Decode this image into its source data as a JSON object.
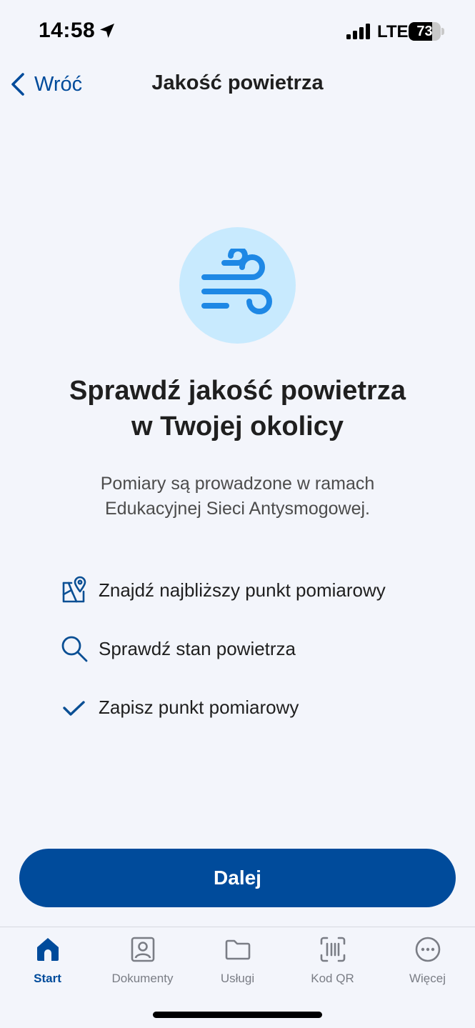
{
  "status_bar": {
    "time": "14:58",
    "network": "LTE",
    "battery_level": 73,
    "battery_label": "73",
    "icons": [
      "location-arrow-icon",
      "signal-icon",
      "battery-icon"
    ]
  },
  "nav": {
    "back_label": "Wróć",
    "title": "Jakość powietrza"
  },
  "hero": {
    "icon": "wind-icon",
    "circle_color": "#c8eafe",
    "icon_color": "#1e88e5"
  },
  "headline": {
    "line1": "Sprawdź jakość powietrza",
    "line2": "w Twojej okolicy"
  },
  "subtext": {
    "line1": "Pomiary są prowadzone w ramach",
    "line2": "Edukacyjnej Sieci Antysmogowej."
  },
  "features": [
    {
      "icon": "map-pin-icon",
      "label": "Znajdź najbliższy punkt pomiarowy"
    },
    {
      "icon": "search-icon",
      "label": "Sprawdź stan powietrza"
    },
    {
      "icon": "checkmark-icon",
      "label": "Zapisz punkt pomiarowy"
    }
  ],
  "primary_button": {
    "label": "Dalej"
  },
  "tab_bar": {
    "active": "Start",
    "tabs": [
      {
        "label": "Start",
        "icon": "home-icon"
      },
      {
        "label": "Dokumenty",
        "icon": "id-card-icon"
      },
      {
        "label": "Usługi",
        "icon": "folder-icon"
      },
      {
        "label": "Kod QR",
        "icon": "qr-code-icon"
      },
      {
        "label": "Więcej",
        "icon": "more-icon"
      }
    ]
  },
  "colors": {
    "accent": "#004b9b",
    "background": "#f3f5fb",
    "inactive_tab": "#7a7d85"
  }
}
